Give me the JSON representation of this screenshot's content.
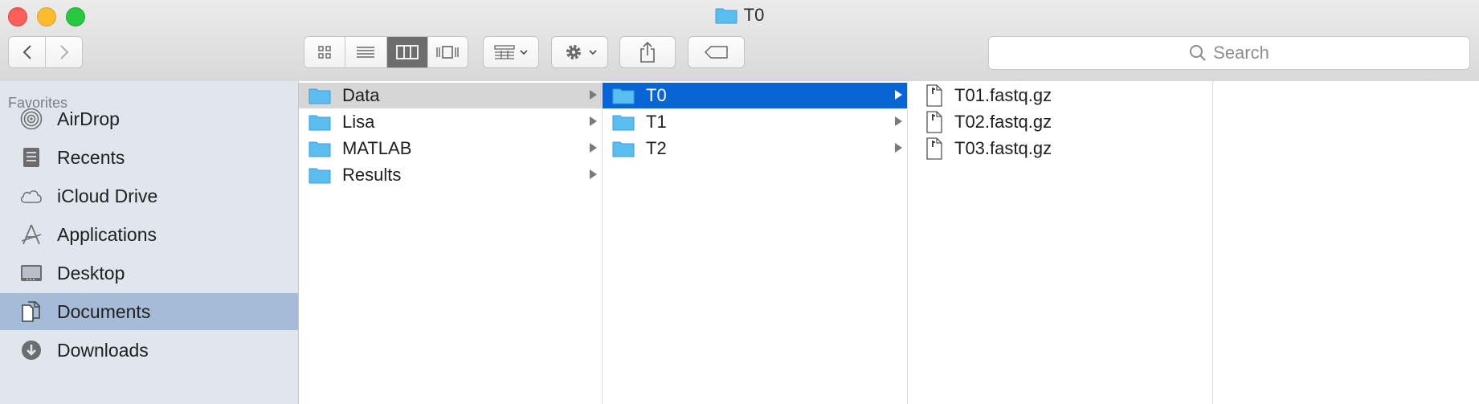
{
  "window": {
    "title": "T0"
  },
  "toolbar": {
    "view_modes": [
      "icon-view",
      "list-view",
      "column-view",
      "cover-flow-view"
    ],
    "active_view": "column-view",
    "search_placeholder": "Search"
  },
  "sidebar": {
    "heading": "Favorites",
    "items": [
      {
        "label": "AirDrop",
        "icon": "airdrop-icon"
      },
      {
        "label": "Recents",
        "icon": "recents-icon"
      },
      {
        "label": "iCloud Drive",
        "icon": "cloud-icon"
      },
      {
        "label": "Applications",
        "icon": "applications-icon"
      },
      {
        "label": "Desktop",
        "icon": "desktop-icon"
      },
      {
        "label": "Documents",
        "icon": "documents-icon",
        "selected": true
      },
      {
        "label": "Downloads",
        "icon": "downloads-icon"
      }
    ]
  },
  "columns": [
    {
      "items": [
        {
          "name": "Data",
          "state": "path"
        },
        {
          "name": "Lisa"
        },
        {
          "name": "MATLAB"
        },
        {
          "name": "Results"
        }
      ]
    },
    {
      "items": [
        {
          "name": "T0",
          "state": "selected"
        },
        {
          "name": "T1"
        },
        {
          "name": "T2"
        }
      ]
    },
    {
      "items": [
        {
          "name": "T01.fastq.gz"
        },
        {
          "name": "T02.fastq.gz"
        },
        {
          "name": "T03.fastq.gz"
        }
      ]
    }
  ],
  "colors": {
    "selection": "#0964d6",
    "folder": "#5bbdf0",
    "sidebar_bg": "#dfe6ee",
    "sidebar_selected": "#a6bbd8"
  }
}
